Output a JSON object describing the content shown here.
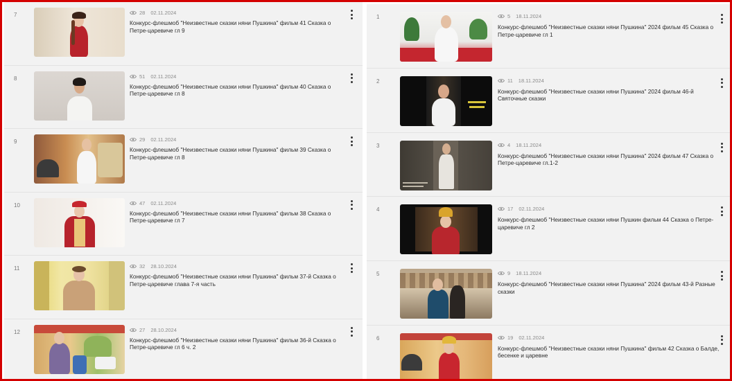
{
  "left_list": [
    {
      "num": "7",
      "views": "28",
      "date": "02.11.2024",
      "title": "Конкурс-флешмоб \"Неизвестные сказки няни Пушкина\" фильм 41 Сказка о Петре-царевиче гл 9"
    },
    {
      "num": "8",
      "views": "51",
      "date": "02.11.2024",
      "title": "Конкурс-флешмоб \"Неизвестные сказки няни Пушкина\" фильм 40 Сказка о Петре-царевиче гл 8"
    },
    {
      "num": "9",
      "views": "29",
      "date": "02.11.2024",
      "title": "Конкурс-флешмоб \"Неизвестные сказки няни Пушкина\" фильм 39 Сказка о Петре-царевиче гл 8"
    },
    {
      "num": "10",
      "views": "47",
      "date": "02.11.2024",
      "title": "Конкурс-флешмоб \"Неизвестные сказки няни Пушкина\" фильм 38 Сказка о Петре-царевиче гл 7"
    },
    {
      "num": "11",
      "views": "32",
      "date": "28.10.2024",
      "title": "Конкурс-флешмоб \"Неизвестные сказки няни Пушкина\" фильм 37-й Сказка о Петре-царевиче глава 7-я часть"
    },
    {
      "num": "12",
      "views": "27",
      "date": "28.10.2024",
      "title": "Конкурс-флешмоб \"Неизвестные сказки няни Пушкина\" фильм 36-й Сказка о Петре-царевиче гл 6 ч. 2"
    }
  ],
  "right_list": [
    {
      "num": "1",
      "views": "5",
      "date": "18.11.2024",
      "title": "Конкурс-флешмоб \"Неизвестные сказки няни Пушкина\" 2024 фильм 45 Сказка о Петре-царевиче гл 1"
    },
    {
      "num": "2",
      "views": "11",
      "date": "18.11.2024",
      "title": "Конкурс-флешмоб \"Неизвестные сказки няни Пушкина\" 2024 фильм 46-й Святочные сказки"
    },
    {
      "num": "3",
      "views": "4",
      "date": "18.11.2024",
      "title": "Конкурс-флешмоб \"Неизвестные сказки няни Пушкина\" 2024 фильм 47 Сказка о Петре-царевиче гл.1-2"
    },
    {
      "num": "4",
      "views": "17",
      "date": "02.11.2024",
      "title": "Конкурс-флешмоб \"Неизвестные сказки няни Пушкин фильм 44 Сказка о Петре-царевиче гл 2"
    },
    {
      "num": "5",
      "views": "9",
      "date": "18.11.2024",
      "title": "Конкурс-флешмоб \"Неизвестные сказки няни Пушкина\" 2024 фильм 43-й Разные сказки"
    },
    {
      "num": "6",
      "views": "19",
      "date": "02.11.2024",
      "title": "Конкурс-флешмоб \"Неизвестные сказки няни Пушкина\" фильм 42 Сказка о Балде, бесенке и царевне"
    }
  ],
  "colors": {
    "frame_border": "#d40000",
    "panel_bg": "#f2f2f2",
    "meta_text": "#8a8a8a"
  }
}
